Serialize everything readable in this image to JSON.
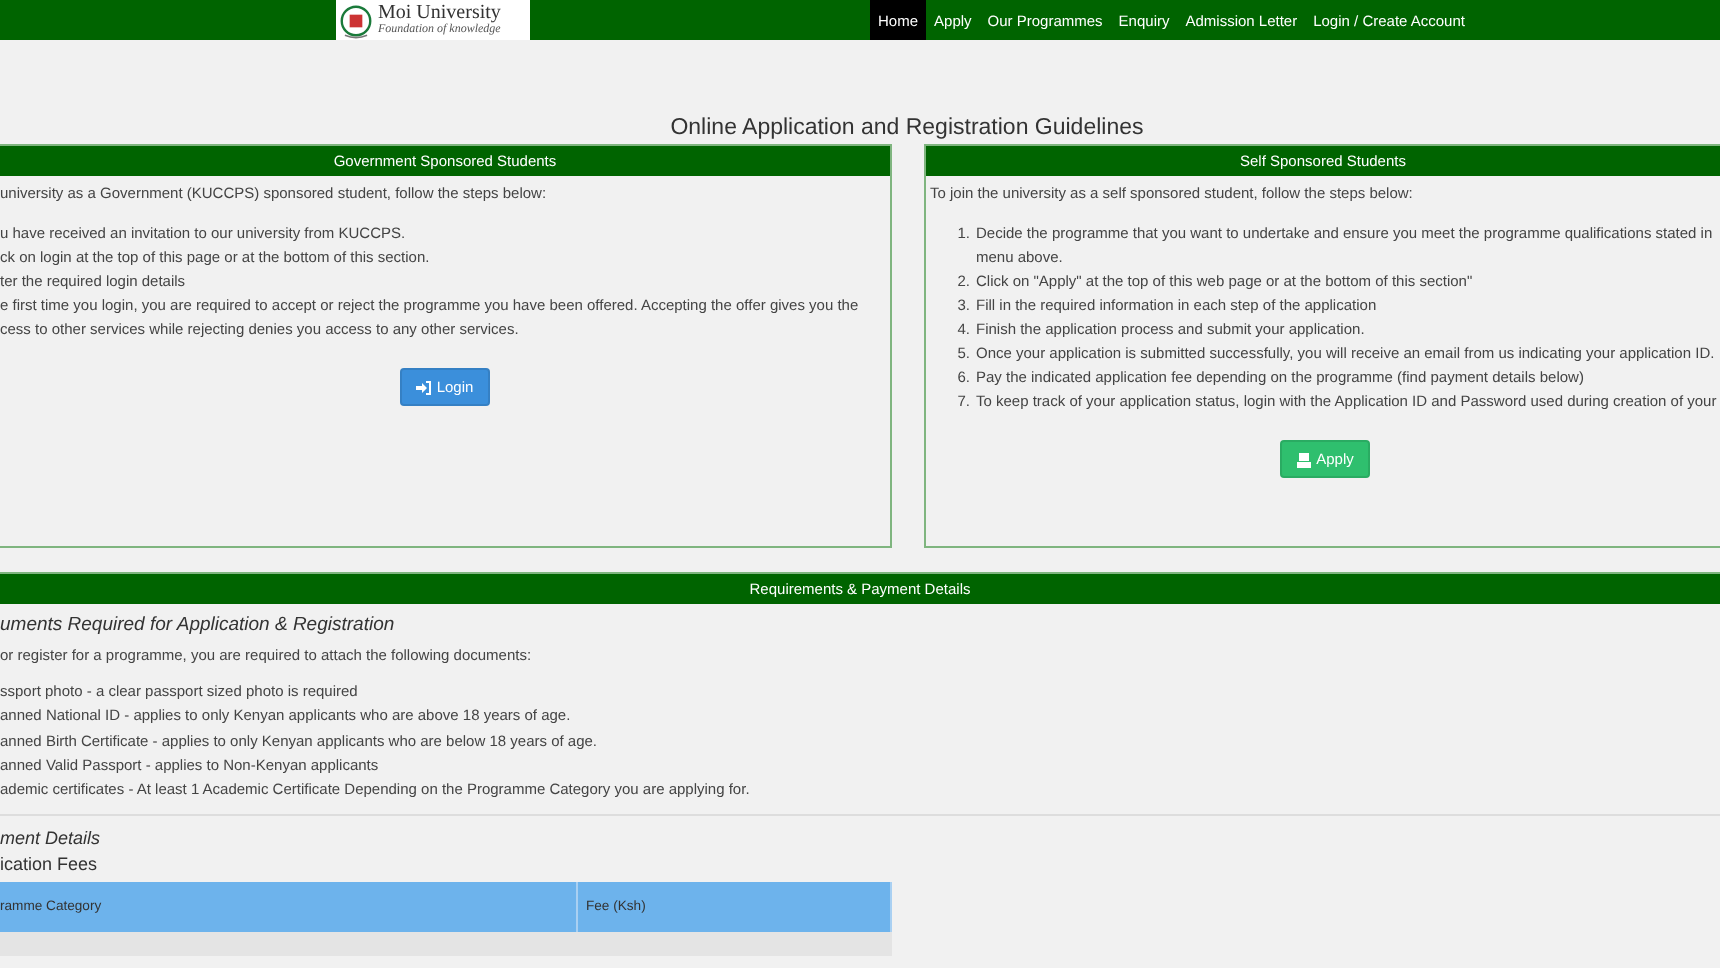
{
  "nav": {
    "logo": {
      "name": "Moi University",
      "motto": "Foundation of knowledge"
    },
    "links": [
      {
        "label": "Home",
        "selected": true
      },
      {
        "label": "Apply",
        "selected": false
      },
      {
        "label": "Our Programmes",
        "selected": false
      },
      {
        "label": "Enquiry",
        "selected": false
      },
      {
        "label": "Admission Letter",
        "selected": false
      },
      {
        "label": "Login / Create Account",
        "selected": false
      }
    ]
  },
  "page_title": "Online Application and Registration Guidelines",
  "panels": [
    {
      "title": "Government Sponsored Students",
      "intro": "university as a Government (KUCCPS) sponsored student, follow the steps below:",
      "steps": [
        {
          "lines": [
            "u have received an invitation to our university from KUCCPS."
          ]
        },
        {
          "lines": [
            "ck on login at the top of this page or at the bottom of this section."
          ]
        },
        {
          "lines": [
            "ter the required login details"
          ]
        },
        {
          "lines": [
            "e first time you login, you are required to accept or reject the programme you have been offered. Accepting the offer gives you the",
            "cess to other services while rejecting denies you access to any other services."
          ]
        }
      ],
      "button": {
        "label": "Login",
        "kind": "login"
      }
    },
    {
      "title": "Self Sponsored Students",
      "intro": "To join the university as a self sponsored student, follow the steps below:",
      "steps": [
        {
          "number": "1.",
          "lines": [
            "Decide the programme that you want to undertake and ensure you meet the programme qualifications stated in",
            "menu above."
          ]
        },
        {
          "number": "2.",
          "lines": [
            "Click on \"Apply\" at the top of this web page or at the bottom of this section\""
          ]
        },
        {
          "number": "3.",
          "lines": [
            "Fill in the required information in each step of the application"
          ]
        },
        {
          "number": "4.",
          "lines": [
            "Finish the application process and submit your application."
          ]
        },
        {
          "number": "5.",
          "lines": [
            "Once your application is submitted successfully, you will receive an email from us indicating your application ID."
          ]
        },
        {
          "number": "6.",
          "lines": [
            "Pay the indicated application fee depending on the programme (find payment details below)"
          ]
        },
        {
          "number": "7.",
          "lines": [
            "To keep track of your application status, login with the Application ID and Password used during creation of your"
          ]
        }
      ],
      "button": {
        "label": "Apply",
        "kind": "apply"
      }
    }
  ],
  "requirements": {
    "title": "Requirements & Payment Details",
    "heading": "uments Required for Application & Registration",
    "intro": "or register for a programme, you are required to attach the following documents:",
    "documents": [
      "ssport photo - a clear passport sized photo is required",
      "anned National ID - applies to only Kenyan applicants who are above 18 years of age.",
      "anned Birth Certificate - applies to only Kenyan applicants who are below 18 years of age.",
      "anned Valid Passport - applies to Non-Kenyan applicants",
      "ademic certificates - At least 1 Academic Certificate Depending on the Programme Category you are applying for."
    ],
    "payment_heading": "ment Details",
    "fees_heading": "ication Fees",
    "table": {
      "columns": [
        "ramme Category",
        "Fee (Ksh)"
      ]
    }
  }
}
